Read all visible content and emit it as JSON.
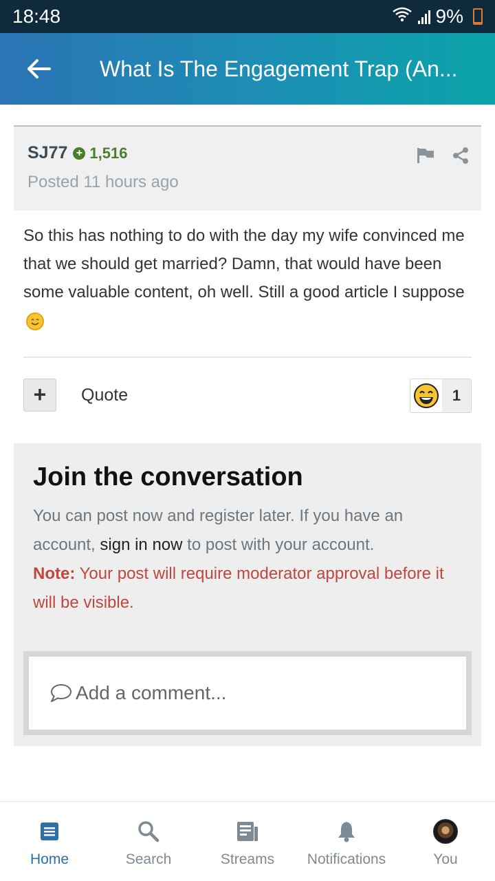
{
  "status_bar": {
    "time": "18:48",
    "battery": "9%"
  },
  "header": {
    "title": "What Is The Engagement Trap (An..."
  },
  "post": {
    "author": "SJ77",
    "reputation": "1,516",
    "posted": "Posted 11 hours ago",
    "body": "So this has nothing to do with the day my wife convinced me that we should get married? Damn, that would have been some valuable content, oh well. Still a good article I suppose",
    "quote_label": "Quote",
    "plus_label": "+",
    "reaction_count": "1"
  },
  "join": {
    "title": "Join the conversation",
    "text_before": "You can post now and register later. If you have an account,",
    "sign_in": "sign in now",
    "text_after": "to post with your account.",
    "note_label": "Note:",
    "note_text": "Your post will require moderator approval before it will be visible.",
    "comment_placeholder": "Add a comment..."
  },
  "nav": {
    "home": "Home",
    "search": "Search",
    "streams": "Streams",
    "notifications": "Notifications",
    "you": "You"
  },
  "colors": {
    "accent": "#2f6ea7",
    "reputation": "#4b7d2f",
    "note": "#c0463f"
  }
}
